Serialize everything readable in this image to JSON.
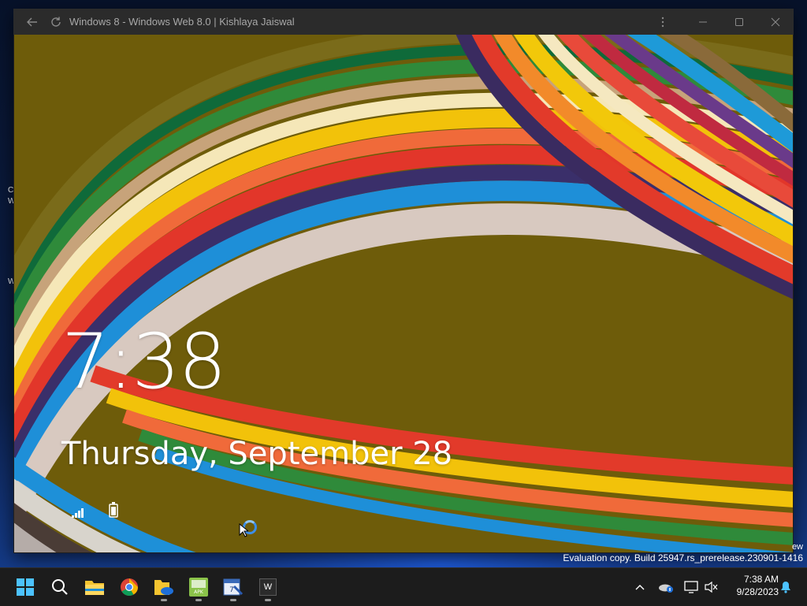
{
  "window": {
    "title": "Windows 8 - Windows Web 8.0 | Kishlaya Jaiswal",
    "icons": [
      "back-arrow-icon",
      "refresh-icon",
      "more-icon",
      "minimize-icon",
      "maximize-icon",
      "close-icon"
    ]
  },
  "lockscreen": {
    "time": "7:38",
    "date": "Thursday, September 28",
    "status_icons": [
      "network-signal-icon",
      "battery-icon"
    ]
  },
  "desktop": {
    "watermark": "Evaluation copy. Build 25947.rs_prerelease.230901-1416",
    "watermark_fragment": "ew",
    "icon_label_fragments": [
      "C",
      "W",
      "W"
    ]
  },
  "taskbar": {
    "apps": [
      {
        "name": "Start",
        "icon": "windows-start-icon"
      },
      {
        "name": "Search",
        "icon": "search-icon"
      },
      {
        "name": "File Explorer",
        "icon": "file-explorer-icon"
      },
      {
        "name": "Google Chrome",
        "icon": "chrome-icon"
      },
      {
        "name": "OneDrive folder",
        "icon": "onedrive-folder-icon"
      },
      {
        "name": "APK installer",
        "icon": "apk-icon"
      },
      {
        "name": "Calendar tool",
        "icon": "calendar-tool-icon"
      },
      {
        "name": "Windows 8 web app",
        "icon": "w-app-icon",
        "label": "W"
      }
    ],
    "tray": {
      "icons": [
        "chevron-up-icon",
        "onedrive-status-icon",
        "display-icon",
        "volume-muted-icon",
        "notification-bell-icon"
      ],
      "time": "7:38 AM",
      "date": "9/28/2023"
    }
  },
  "colors": {
    "titlebar": "#2b2b2b",
    "taskbar": "#1c1c1c",
    "accent": "#0078d4"
  }
}
